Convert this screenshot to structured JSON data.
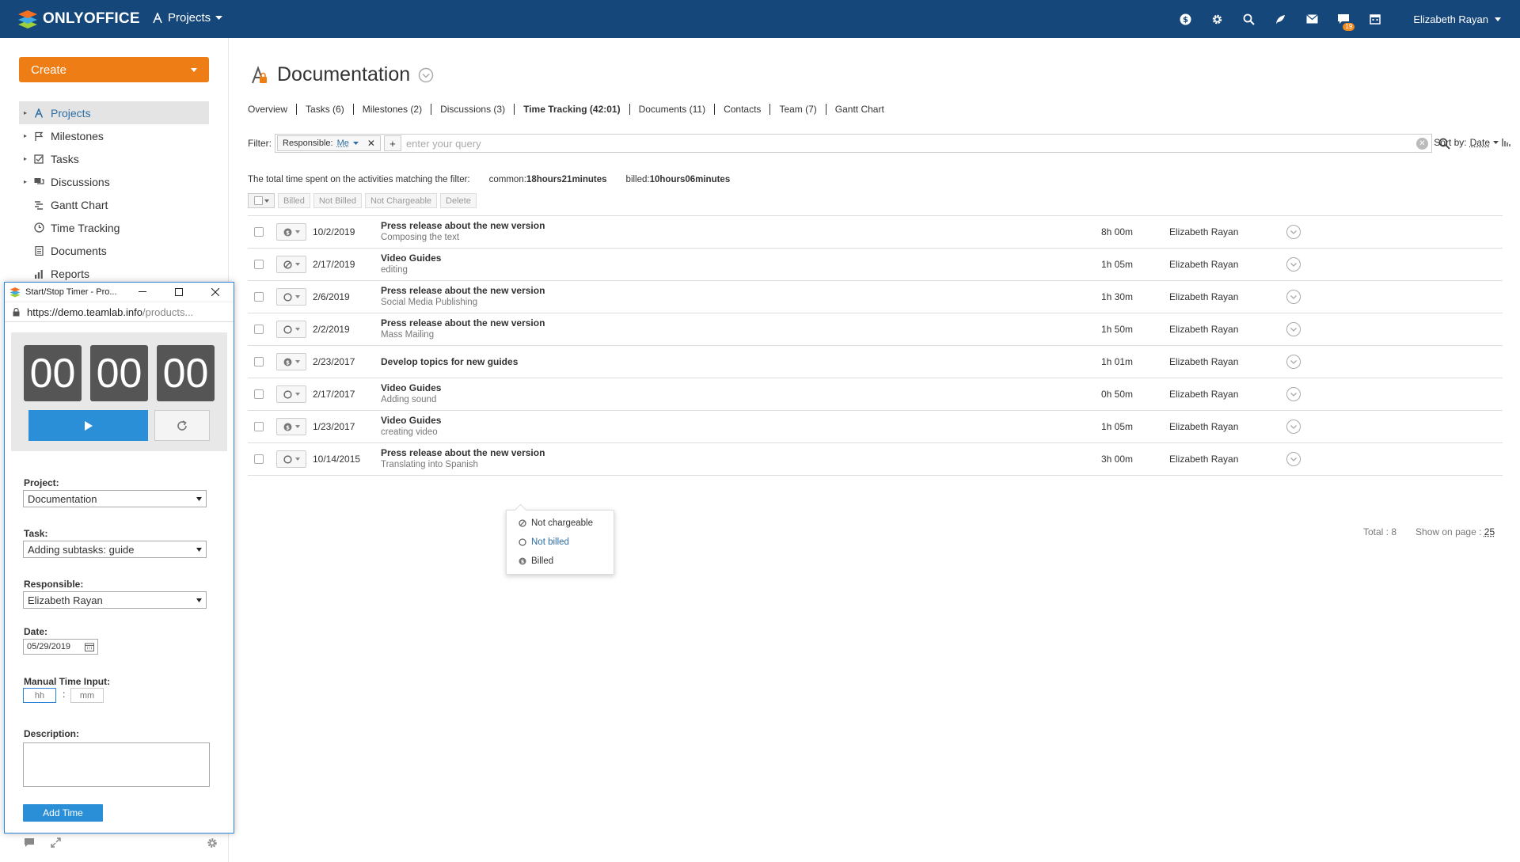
{
  "header": {
    "logo_text": "ONLYOFFICE",
    "product": "Projects",
    "user": "Elizabeth Rayan",
    "chat_badge": "19",
    "icons": [
      "currency-icon",
      "gear-icon",
      "search-icon",
      "feed-icon",
      "mail-icon",
      "chat-icon",
      "calendar-icon"
    ]
  },
  "sidebar": {
    "create_label": "Create",
    "items": [
      {
        "label": "Projects",
        "icon": "projects-icon",
        "arrow": true,
        "active": true
      },
      {
        "label": "Milestones",
        "icon": "flag-icon",
        "arrow": true
      },
      {
        "label": "Tasks",
        "icon": "checkbox-icon",
        "arrow": true
      },
      {
        "label": "Discussions",
        "icon": "discussion-icon",
        "arrow": true
      },
      {
        "label": "Gantt Chart",
        "icon": "gantt-icon"
      },
      {
        "label": "Time Tracking",
        "icon": "clock-icon"
      },
      {
        "label": "Documents",
        "icon": "document-icon"
      },
      {
        "label": "Reports",
        "icon": "reports-icon"
      }
    ]
  },
  "page": {
    "title": "Documentation",
    "tabs": [
      {
        "label": "Overview"
      },
      {
        "label": "Tasks (6)"
      },
      {
        "label": "Milestones (2)"
      },
      {
        "label": "Discussions (3)"
      },
      {
        "label": "Time Tracking (42:01)",
        "active": true
      },
      {
        "label": "Documents (11)"
      },
      {
        "label": "Contacts"
      },
      {
        "label": "Team (7)"
      },
      {
        "label": "Gantt Chart"
      }
    ],
    "filter": {
      "label": "Filter:",
      "tag_key": "Responsible:",
      "tag_value": "Me",
      "placeholder": "enter your query",
      "sort_label": "Sort by:",
      "sort_value": "Date"
    },
    "summary": {
      "text": "The total time spent on the activities matching the filter:",
      "common_label": "common:",
      "common_value": "18hours21minutes",
      "billed_label": "billed:",
      "billed_value": "10hours06minutes"
    },
    "actions": [
      "Billed",
      "Not Billed",
      "Not Chargeable",
      "Delete"
    ],
    "rows": [
      {
        "status": "billed",
        "date": "10/2/2019",
        "title": "Press release about the new version",
        "note": "Composing the text",
        "hours": "8h 00m",
        "person": "Elizabeth Rayan"
      },
      {
        "status": "not-chargeable",
        "date": "2/17/2019",
        "title": "Video Guides",
        "note": "editing",
        "hours": "1h 05m",
        "person": "Elizabeth Rayan"
      },
      {
        "status": "not-billed",
        "date": "2/6/2019",
        "title": "Press release about the new version",
        "note": "Social Media Publishing",
        "hours": "1h 30m",
        "person": "Elizabeth Rayan"
      },
      {
        "status": "not-billed",
        "date": "2/2/2019",
        "title": "Press release about the new version",
        "note": "Mass Mailing",
        "hours": "1h 50m",
        "person": "Elizabeth Rayan"
      },
      {
        "status": "billed",
        "date": "2/23/2017",
        "title": "Develop topics for new guides",
        "note": "",
        "hours": "1h 01m",
        "person": "Elizabeth Rayan"
      },
      {
        "status": "not-billed",
        "date": "2/17/2017",
        "title": "Video Guides",
        "note": "Adding sound",
        "hours": "0h 50m",
        "person": "Elizabeth Rayan"
      },
      {
        "status": "billed",
        "date": "1/23/2017",
        "title": "Video Guides",
        "note": "creating video",
        "hours": "1h 05m",
        "person": "Elizabeth Rayan"
      },
      {
        "status": "not-billed",
        "date": "10/14/2015",
        "title": "Press release about the new version",
        "note": "Translating into Spanish",
        "hours": "3h 00m",
        "person": "Elizabeth Rayan"
      }
    ],
    "status_menu": [
      {
        "label": "Not chargeable",
        "icon": "not-chargeable-icon"
      },
      {
        "label": "Not billed",
        "icon": "not-billed-icon",
        "selected": true
      },
      {
        "label": "Billed",
        "icon": "billed-icon"
      }
    ],
    "pager": {
      "total": "Total : 8",
      "show_label": "Show on page :",
      "per_page": "25"
    }
  },
  "timer_window": {
    "title": "Start/Stop Timer - Pro...",
    "url_host": "https://demo.teamlab.info",
    "url_path": "/products...",
    "hours": "00",
    "minutes": "00",
    "seconds": "00",
    "project_label": "Project:",
    "project_value": "Documentation",
    "task_label": "Task:",
    "task_value": "Adding subtasks: guide",
    "responsible_label": "Responsible:",
    "responsible_value": "Elizabeth Rayan",
    "date_label": "Date:",
    "date_value": "05/29/2019",
    "manual_label": "Manual Time Input:",
    "hours_placeholder": "hh",
    "minutes_placeholder": "mm",
    "separator": ":",
    "description_label": "Description:",
    "add_label": "Add Time"
  },
  "colors": {
    "header": "#15477b",
    "create": "#ef7d15",
    "accent": "#2b8fd8",
    "link": "#2c6da3"
  }
}
